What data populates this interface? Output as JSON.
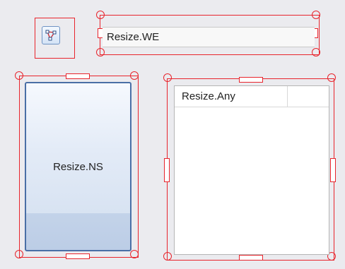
{
  "icon_button": {
    "icon": "nodes-connection-icon",
    "accent_color": "#6f93c3",
    "selection_color": "#e8242c"
  },
  "resize_we": {
    "label": "Resize.WE"
  },
  "resize_ns": {
    "label": "Resize.NS"
  },
  "resize_any": {
    "header": "Resize.Any"
  }
}
